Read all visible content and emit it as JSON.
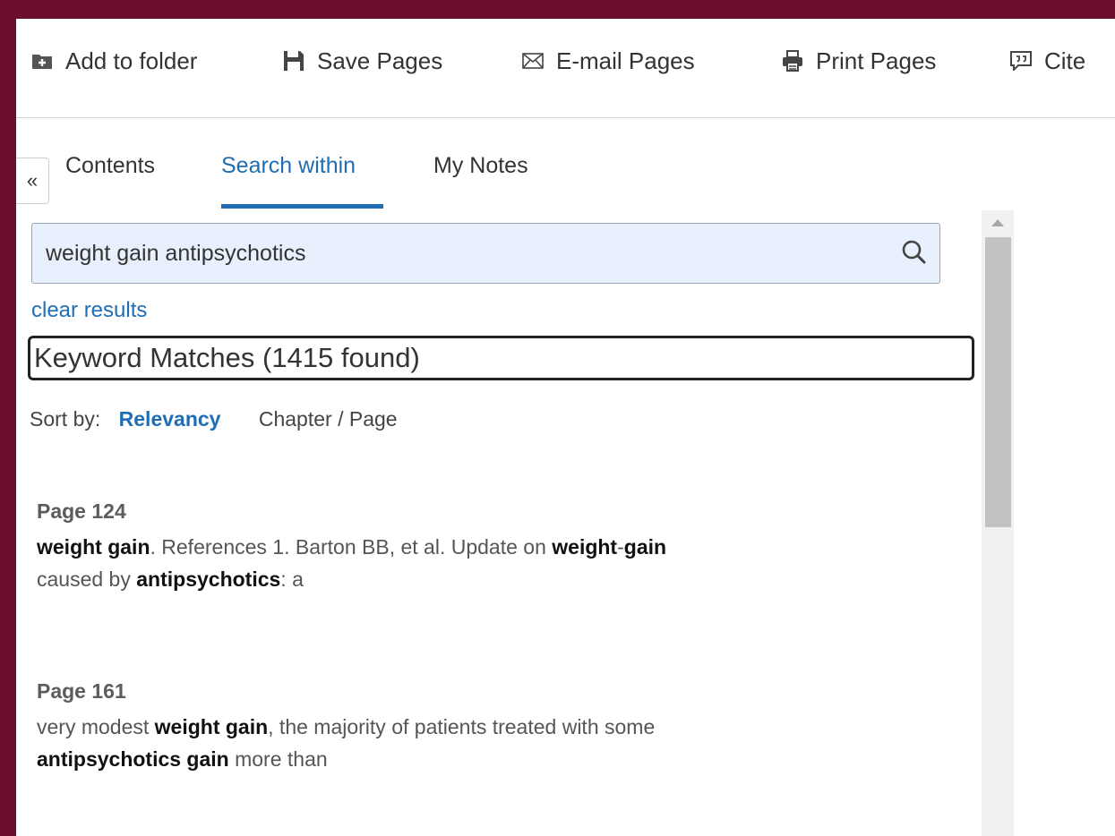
{
  "toolbar": {
    "add_to_folder": "Add to folder",
    "save_pages": "Save Pages",
    "email_pages": "E-mail Pages",
    "print_pages": "Print Pages",
    "cite": "Cite"
  },
  "tabs": {
    "collapse": "«",
    "contents": "Contents",
    "search_within": "Search within",
    "my_notes": "My Notes",
    "active": "search_within"
  },
  "search": {
    "value": "weight gain antipsychotics",
    "placeholder": "",
    "clear": "clear results"
  },
  "matches": {
    "heading": "Keyword Matches (1415 found)"
  },
  "sort": {
    "label": "Sort by:",
    "options": [
      "Relevancy",
      "Chapter / Page"
    ],
    "selected": "Relevancy"
  },
  "results": [
    {
      "page": "Page 124",
      "line1_b1": "weight gain",
      "line1_t1": ". References 1. Barton BB, et al. Update on ",
      "line1_b2": "weight",
      "line1_t2": "-",
      "line1_b3": "gain",
      "line2_t1": "caused by ",
      "line2_b1": "antipsychotics",
      "line2_t2": ": a"
    },
    {
      "page": "Page 161",
      "line1_t1": "very modest ",
      "line1_b1": "weight gain",
      "line1_t2": ", the majority of patients treated with some",
      "line2_b1": "antipsychotics gain",
      "line2_t1": " more than"
    }
  ],
  "colors": {
    "frame": "#6b0f2c",
    "accent": "#1f6eb4",
    "search_bg": "#e8f0fe"
  }
}
